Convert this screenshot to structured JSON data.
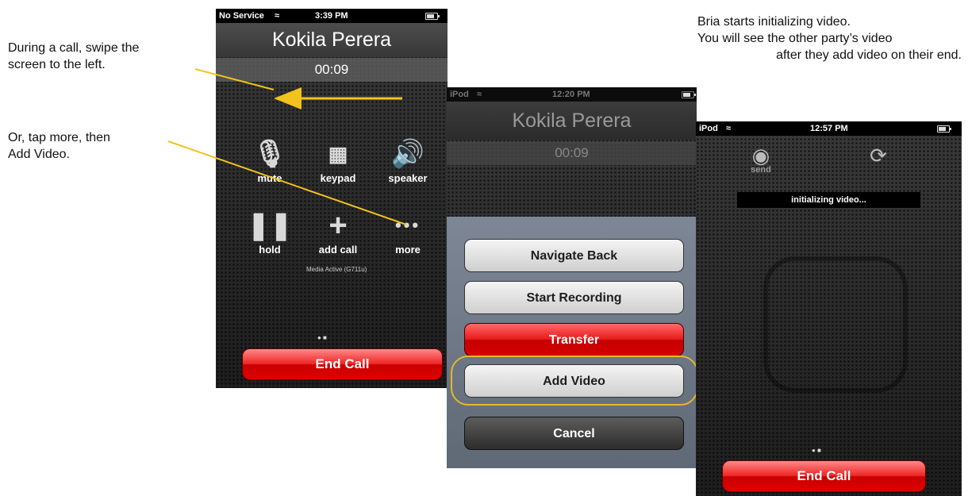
{
  "annotations": {
    "swipe": "During a call, swipe the\nscreen to the left.",
    "tap_more": "Or, tap more, then\nAdd Video.",
    "bria_line1": "Bria starts initializing video.",
    "bria_line2": "You will see the other party’s video",
    "bria_line3": "after they add video on their end."
  },
  "colors": {
    "callout_line": "#f2c31c",
    "end_call_red": "#e00000",
    "highlight": "#e3b82a"
  },
  "phone1": {
    "carrier": "No Service",
    "time": "3:39 PM",
    "contact_name": "Kokila Perera",
    "call_timer": "00:09",
    "buttons": [
      {
        "label": "mute",
        "icon": "mic-muted-icon"
      },
      {
        "label": "keypad",
        "icon": "keypad-icon"
      },
      {
        "label": "speaker",
        "icon": "speaker-icon"
      },
      {
        "label": "hold",
        "icon": "pause-icon"
      },
      {
        "label": "add call",
        "icon": "plus-icon"
      },
      {
        "label": "more",
        "icon": "more-dots-icon"
      }
    ],
    "media_status": "Media Active (G711u)",
    "end_call": "End Call"
  },
  "phone2": {
    "carrier": "iPod",
    "time": "12:20 PM",
    "contact_name": "Kokila Perera",
    "call_timer": "00:09",
    "sheet_buttons": [
      "Navigate Back",
      "Start Recording",
      "Transfer",
      "Add Video"
    ],
    "cancel": "Cancel"
  },
  "phone3": {
    "carrier": "iPod",
    "time": "12:57 PM",
    "send_label": "send",
    "video_status": "initializing video...",
    "end_call": "End Call"
  }
}
